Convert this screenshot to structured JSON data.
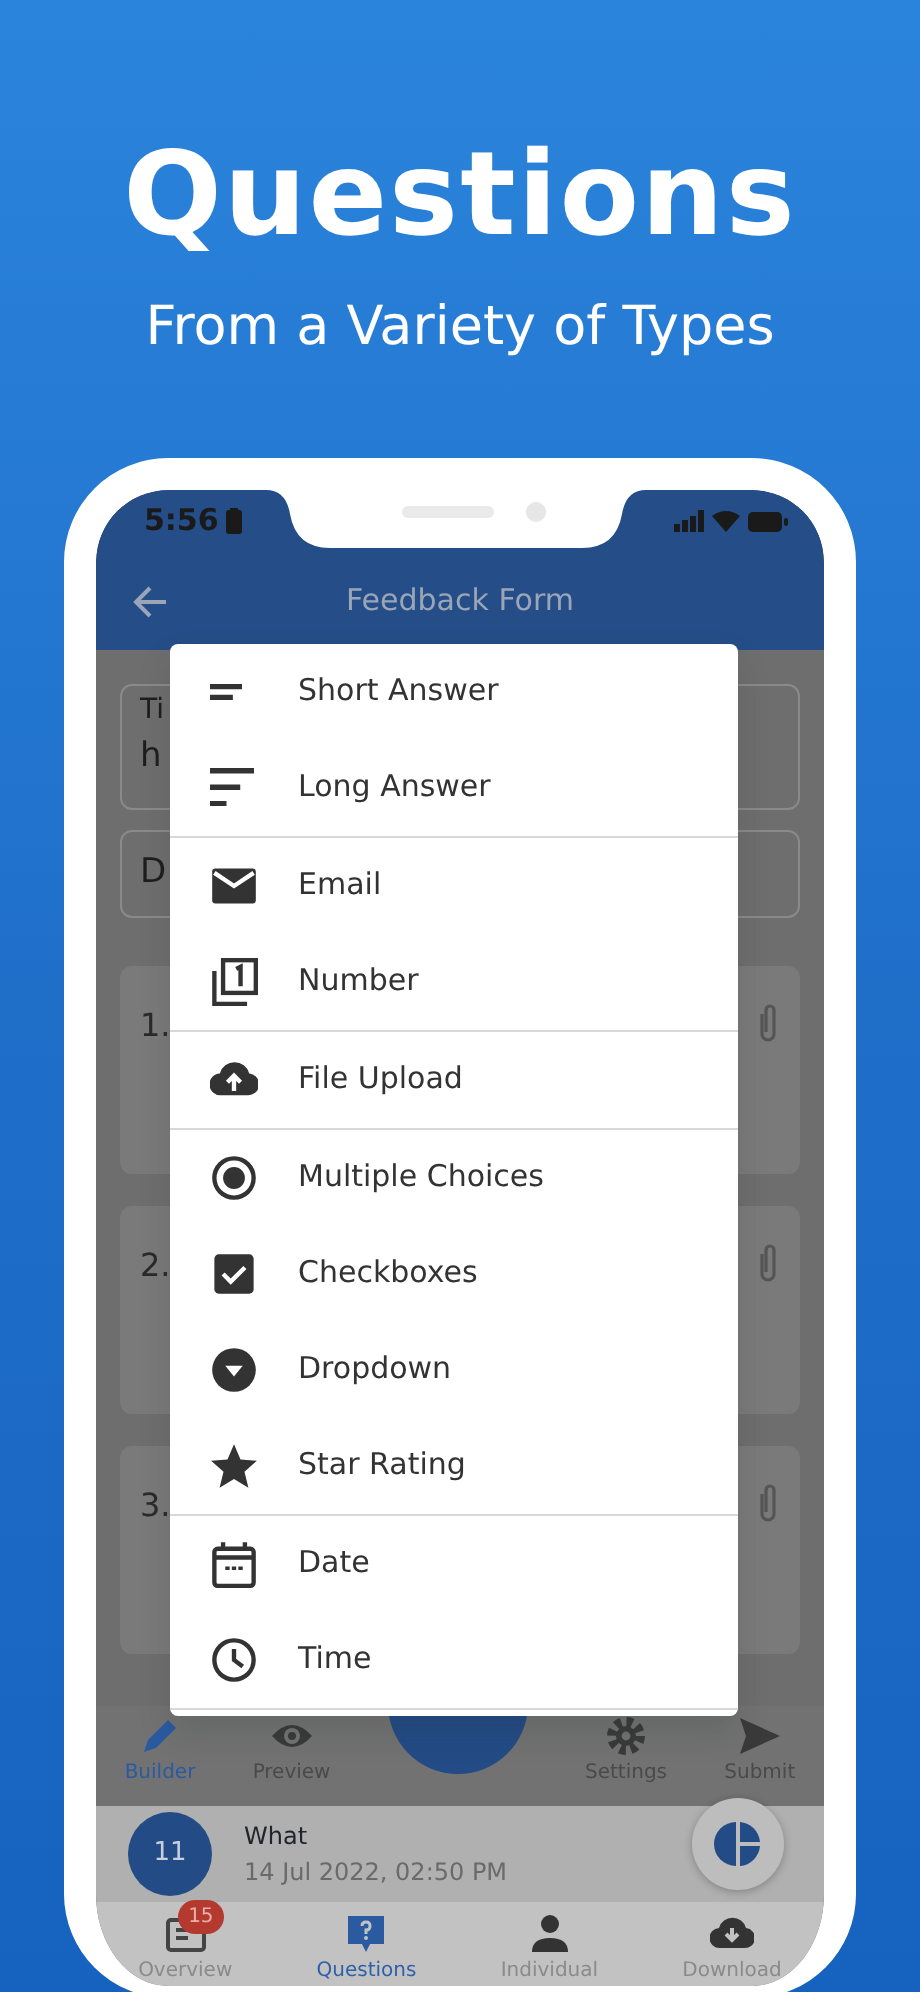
{
  "hero": {
    "title": "Questions",
    "subtitle": "From a Variety of Types"
  },
  "status_bar": {
    "time": "5:56"
  },
  "app_bar": {
    "title": "Feedback Form"
  },
  "form_fields": [
    {
      "label": "Ti",
      "value": "h"
    },
    {
      "value": "D"
    }
  ],
  "question_cards": [
    {
      "number": "1."
    },
    {
      "number": "2."
    },
    {
      "number": "3."
    }
  ],
  "menu": {
    "groups": [
      [
        {
          "label": "Short Answer",
          "kind": "short"
        },
        {
          "label": "Long Answer",
          "kind": "long"
        }
      ],
      [
        {
          "label": "Email",
          "kind": "email"
        },
        {
          "label": "Number",
          "kind": "number"
        }
      ],
      [
        {
          "label": "File Upload",
          "kind": "upload"
        }
      ],
      [
        {
          "label": "Multiple Choices",
          "kind": "radio"
        },
        {
          "label": "Checkboxes",
          "kind": "checkbox"
        },
        {
          "label": "Dropdown",
          "kind": "dropdown"
        },
        {
          "label": "Star Rating",
          "kind": "star"
        }
      ],
      [
        {
          "label": "Date",
          "kind": "date"
        },
        {
          "label": "Time",
          "kind": "time"
        }
      ]
    ]
  },
  "builder_toolbar": [
    {
      "label": "Builder",
      "kind": "pencil",
      "selected": true
    },
    {
      "label": "Preview",
      "kind": "eye",
      "selected": false
    },
    {
      "kind": "center"
    },
    {
      "label": "Settings",
      "kind": "gear",
      "selected": false
    },
    {
      "label": "Submit",
      "kind": "send",
      "selected": false
    }
  ],
  "response": {
    "avatar": "11",
    "title": "What",
    "time": "14 Jul 2022, 02:50 PM"
  },
  "bottom_nav": [
    {
      "label": "Overview",
      "kind": "overview",
      "badge": "15",
      "selected": false
    },
    {
      "label": "Questions",
      "kind": "questions",
      "selected": true
    },
    {
      "label": "Individual",
      "kind": "person",
      "selected": false
    },
    {
      "label": "Download",
      "kind": "download",
      "selected": false
    }
  ]
}
